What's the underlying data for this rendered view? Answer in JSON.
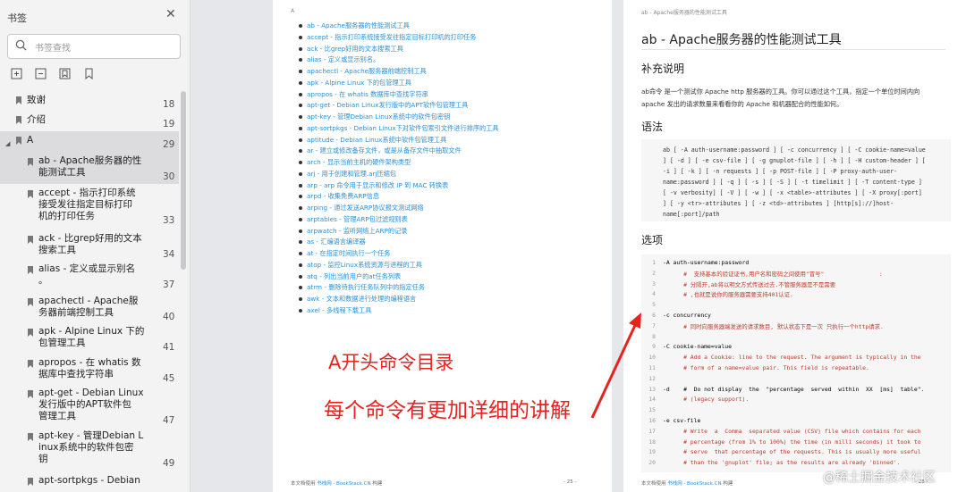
{
  "sidebar": {
    "title": "书签",
    "search_placeholder": "书签查找",
    "items": [
      {
        "label": "致谢",
        "page": "18"
      },
      {
        "label": "介绍",
        "page": "19"
      },
      {
        "label": "A",
        "page": "29"
      },
      {
        "label_lines": [
          "ab - Apache服务器的性",
          "能测试工具"
        ],
        "page": "30"
      },
      {
        "label_lines": [
          "accept - 指示打印系统",
          "接受发往指定目标打印",
          "机的打印任务"
        ],
        "page": "33"
      },
      {
        "label_lines": [
          "ack - 比grep好用的文本",
          "搜索工具"
        ],
        "page": "34"
      },
      {
        "label_lines": [
          "alias - 定义或显示别名",
          "。"
        ],
        "page": "37"
      },
      {
        "label_lines": [
          "apachectl - Apache服",
          "务器前端控制工具"
        ],
        "page": "40"
      },
      {
        "label_lines": [
          "apk - Alpine Linux 下的",
          "包管理工具"
        ],
        "page": "41"
      },
      {
        "label_lines": [
          "apropos - 在 whatis 数",
          "据库中查找字符串"
        ],
        "page": "45"
      },
      {
        "label_lines": [
          "apt-get - Debian Linux",
          "发行版中的APT软件包",
          "管理工具"
        ],
        "page": "47"
      },
      {
        "label_lines": [
          "apt-key - 管理Debian L",
          "inux系统中的软件包密",
          "钥"
        ],
        "page": "49"
      },
      {
        "label_lines": [
          "apt-sortpkgs - Debian"
        ],
        "page": ""
      }
    ]
  },
  "left_page": {
    "header": "A",
    "commands": [
      "ab - Apache服务器的性能测试工具",
      "accept - 指示打印系统接受发往指定目标打印机的打印任务",
      "ack - 比grep好用的文本搜索工具",
      "alias - 定义或显示别名。",
      "apachectl - Apache服务器前端控制工具",
      "apk - Alpine Linux 下的包管理工具",
      "apropos - 在 whatis 数据库中查找字符串",
      "apt-get - Debian Linux发行版中的APT软件包管理工具",
      "apt-key - 管理Debian Linux系统中的软件包密钥",
      "apt-sortpkgs - Debian Linux下对软件包索引文件进行排序的工具",
      "aptitude - Debian Linux系统中软件包管理工具",
      "ar - 建立或修改备存文件，或是从备存文件中抽取文件",
      "arch - 显示当前主机的硬件架构类型",
      "arj - 用于创建和管理.arj压缩包",
      "arp - arp 命令用于显示和修改 IP 到 MAC 转换表",
      "arpd - 收集免费ARP信息",
      "arping - 通过发送ARP协议报文测试网络",
      "arptables - 管理ARP包过滤规则表",
      "arpwatch - 监听网络上ARP的记录",
      "as - 汇编语言编译器",
      "at - 在指定时间执行一个任务",
      "atop - 监控Linux系统资源与进程的工具",
      "atq - 列出当前用户的at任务列表",
      "atrm - 删除待执行任务队列中的指定任务",
      "awk - 文本和数据进行处理的编程语言",
      "axel - 多线程下载工具"
    ],
    "footer_prefix": "本文档使用",
    "footer_brand": "书栈网 · BookStack.CN",
    "footer_suffix": "构建",
    "page_num": "- 25 -"
  },
  "right_page": {
    "header": "ab - Apache服务器的性能测试工具",
    "title": "ab - Apache服务器的性能测试工具",
    "section1": "补充说明",
    "para_lines": [
      "ab命令 是一个测试你 Apache http 服务器的工具。你可以通过这个工具，指定一个单位时间内向",
      "apache 发出的请求数量来看看你的 Apache 和机器配合的性能如何。"
    ],
    "section2": "语法",
    "syntax_lines": [
      "ab [ -A auth-username:password ] [ -c concurrency ] [ -C cookie-name=value",
      "] [ -d ] [ -e csv-file ] [ -g gnuplot-file ] [ -h ] [ -H custom-header ] [",
      "-i ]  [  -k  ]  [  -n  requests  ] [ -p POST-file ] [ -P proxy-auth-user-",
      "name:password ] [ -q ] [ -s ] [ -S ] [ -t timelimit ] [ -T content-type ]",
      "[  -v verbosity] [ -V ] [ -w ] [ -x <table>-attributes ] [ -X proxy[:port]",
      "] [  -y  <tr>-attributes ]  [  -z   <td>-attributes   ]  [http[s]://]host-",
      "name[:port]/path"
    ],
    "section3": "选项",
    "options": [
      {
        "n": "1",
        "t": "-A auth-username:password",
        "red": false
      },
      {
        "n": "2",
        "t": "      #  支持基本的验证证书,用户名和密码之间使用\"冒号\"                :",
        "red": true
      },
      {
        "n": "3",
        "t": "      # 分隔开,ab将以明文方式传送过去.不管服务器是不是需要",
        "red": true
      },
      {
        "n": "4",
        "t": "      # ,也就是说你的服务器需要支持401认证.",
        "red": true
      },
      {
        "n": "5",
        "t": "",
        "red": false
      },
      {
        "n": "6",
        "t": "-c concurrency",
        "red": false
      },
      {
        "n": "7",
        "t": "      # 同时向服务器端发送的请求数目, 默认状态下是一次 只执行一个http请求.",
        "red": true
      },
      {
        "n": "8",
        "t": "",
        "red": false
      },
      {
        "n": "9",
        "t": "-C cookie-name=value",
        "red": false
      },
      {
        "n": "10",
        "t": "      # Add a Cookie: line to the request. The argument is typically in the",
        "red": true
      },
      {
        "n": "11",
        "t": "      # form of a name=value pair. This field is repeatable.",
        "red": true
      },
      {
        "n": "12",
        "t": "",
        "red": false
      },
      {
        "n": "13",
        "t": "-d    #  Do not display  the  \"percentage  served  within  XX  [ms]  table\".",
        "red": false
      },
      {
        "n": "14",
        "t": "      # (legacy support).",
        "red": true
      },
      {
        "n": "15",
        "t": "",
        "red": false
      },
      {
        "n": "16",
        "t": "-e csv-file",
        "red": false
      },
      {
        "n": "17",
        "t": "      # Write  a  Comma  separated value (CSV) file which contains for each",
        "red": true
      },
      {
        "n": "18",
        "t": "      # percentage (from 1% to 100%) the time (in milli seconds) it took to",
        "red": true
      },
      {
        "n": "19",
        "t": "      # serve  that percentage of the requests. This is usually more useful",
        "red": true
      },
      {
        "n": "20",
        "t": "      # than the 'gnuplot' file; as the results are already 'binned'.",
        "red": true
      }
    ],
    "footer_prefix": "本文档使用",
    "footer_brand": "书栈网 · BookStack.CN",
    "footer_suffix": "构建",
    "page_num": "- 26 -"
  },
  "annotation": {
    "line1": "A开头命令目录",
    "line2": "每个命令有更加详细的讲解",
    "arrow_color": "#e8231f"
  },
  "watermark": "@稀土掘金技术社区"
}
